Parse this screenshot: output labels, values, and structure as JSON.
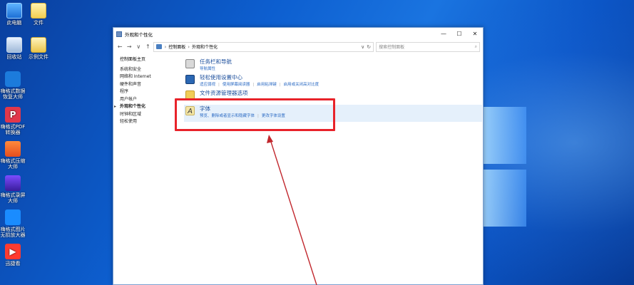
{
  "desktop": {
    "icons": [
      {
        "label": "此电脑",
        "icon": "pc-icon"
      },
      {
        "label": "文件",
        "icon": "folder-icon"
      },
      {
        "label": "回收站",
        "icon": "recycle-bin-icon"
      },
      {
        "label": "示例文件",
        "icon": "folder-icon"
      },
      {
        "label": "嗨格式数据恢复大师",
        "icon": "app-icon"
      },
      {
        "label": "嗨格式PDF转换器",
        "icon": "pdf-app-icon"
      },
      {
        "label": "嗨格式压缩大师",
        "icon": "zip-app-icon"
      },
      {
        "label": "嗨格式录屏大师",
        "icon": "recorder-app-icon"
      },
      {
        "label": "嗨格式图片无损放大器",
        "icon": "image-app-icon"
      },
      {
        "label": "迅捷看",
        "icon": "video-app-icon"
      }
    ]
  },
  "window": {
    "title": "外观和个性化",
    "controls": {
      "minimize": "—",
      "maximize": "☐",
      "close": "✕"
    },
    "nav": {
      "back": "←",
      "forward": "→",
      "dropdown": "∨",
      "up": "↑"
    },
    "address": {
      "root": "控制面板",
      "separator": "›",
      "current": "外观和个性化",
      "dropdown": "∨",
      "refresh": "↻"
    },
    "search": {
      "placeholder": "搜索控制面板",
      "icon": "⌕"
    },
    "sidebar": {
      "home": "控制面板主页",
      "items": [
        "系统和安全",
        "网络和 Internet",
        "硬件和声音",
        "程序",
        "用户帐户",
        "外观和个性化",
        "时钟和区域",
        "轻松使用"
      ],
      "active_index": 5
    },
    "categories": [
      {
        "title": "任务栏和导航",
        "links": [
          "导航属性"
        ]
      },
      {
        "title": "轻松使用设置中心",
        "links": [
          "适应弱视",
          "使用屏幕阅读器",
          "启用粘滞键",
          "启用或关闭高对比度"
        ]
      },
      {
        "title": "文件资源管理器选项",
        "links": []
      },
      {
        "title": "字体",
        "links": [
          "预览、删除或者显示和隐藏字体",
          "更改字体设置"
        ]
      }
    ]
  },
  "annotation": {
    "box_color": "#e8232a",
    "arrow_color": "#c1272d"
  }
}
